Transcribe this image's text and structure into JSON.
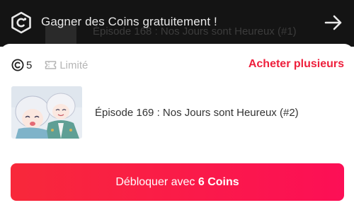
{
  "banner": {
    "text": "Gagner des Coins gratuitement !",
    "behind_title": "Épisode 168 : Nos Jours sont Heureux (#1)",
    "logo_icon": "coin-c-logo-icon",
    "arrow_icon": "arrow-right-icon"
  },
  "sheet": {
    "coin_icon": "coin-icon",
    "coin_count": "5",
    "ticket_icon": "ticket-icon",
    "limited_label": "Limité",
    "buy_multiple": "Acheter plusieurs",
    "episode": {
      "thumbnail": "episode-thumbnail",
      "title": "Épisode 169 : Nos Jours sont Heureux (#2)"
    },
    "unlock": {
      "prefix": "Débloquer avec ",
      "amount": "6 Coins"
    }
  },
  "colors": {
    "accent": "#ee1f3c",
    "button_start": "#f8283a",
    "button_end": "#fc0f56",
    "banner_bg": "#141414",
    "muted": "#b5b5b5"
  }
}
